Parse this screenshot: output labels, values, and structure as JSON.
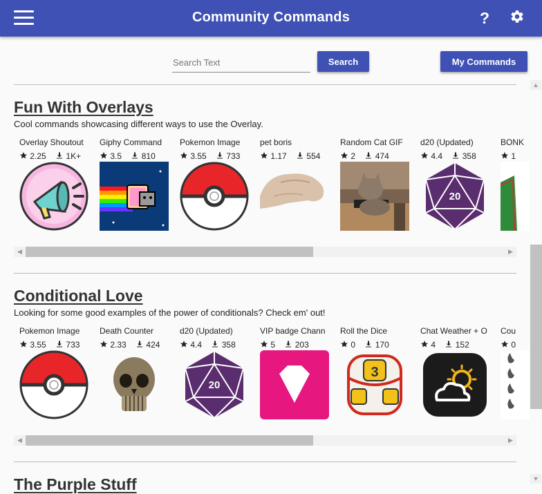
{
  "app": {
    "title": "Community Commands"
  },
  "search": {
    "placeholder": "Search Text",
    "value": "",
    "button_label": "Search"
  },
  "my_commands_label": "My Commands",
  "colors": {
    "primary": "#3f51b5"
  },
  "sections": [
    {
      "title": "Fun With Overlays",
      "description": "Cool commands showcasing different ways to use the Overlay.",
      "items": [
        {
          "name": "Overlay Shoutout",
          "rating": "2.25",
          "downloads": "1K+",
          "icon": "megaphone-icon"
        },
        {
          "name": "Giphy Command",
          "rating": "3.5",
          "downloads": "810",
          "icon": "nyan-cat-image"
        },
        {
          "name": "Pokemon Image",
          "rating": "3.55",
          "downloads": "733",
          "icon": "pokeball-icon"
        },
        {
          "name": "pet boris",
          "rating": "1.17",
          "downloads": "554",
          "icon": "hand-image"
        },
        {
          "name": "Random Cat GIF",
          "rating": "2",
          "downloads": "474",
          "icon": "cat-photo-image"
        },
        {
          "name": "d20 (Updated)",
          "rating": "4.4",
          "downloads": "358",
          "icon": "d20-icon"
        },
        {
          "name": "BONK",
          "rating": "1",
          "downloads": "",
          "icon": "bonk-image"
        }
      ]
    },
    {
      "title": "Conditional Love",
      "description": "Looking for some good examples of the power of conditionals? Check em' out!",
      "items": [
        {
          "name": "Pokemon Image",
          "rating": "3.55",
          "downloads": "733",
          "icon": "pokeball-icon"
        },
        {
          "name": "Death Counter",
          "rating": "2.33",
          "downloads": "424",
          "icon": "skull-image"
        },
        {
          "name": "d20 (Updated)",
          "rating": "4.4",
          "downloads": "358",
          "icon": "d20-icon"
        },
        {
          "name": "VIP badge Chann",
          "rating": "5",
          "downloads": "203",
          "icon": "diamond-icon"
        },
        {
          "name": "Roll the Dice",
          "rating": "0",
          "downloads": "170",
          "icon": "dice-icon"
        },
        {
          "name": "Chat Weather + O",
          "rating": "4",
          "downloads": "152",
          "icon": "weather-icon"
        },
        {
          "name": "Cou",
          "rating": "0",
          "downloads": "",
          "icon": "flames-list-image"
        }
      ]
    },
    {
      "title": "The Purple Stuff",
      "description": "",
      "items": []
    }
  ]
}
